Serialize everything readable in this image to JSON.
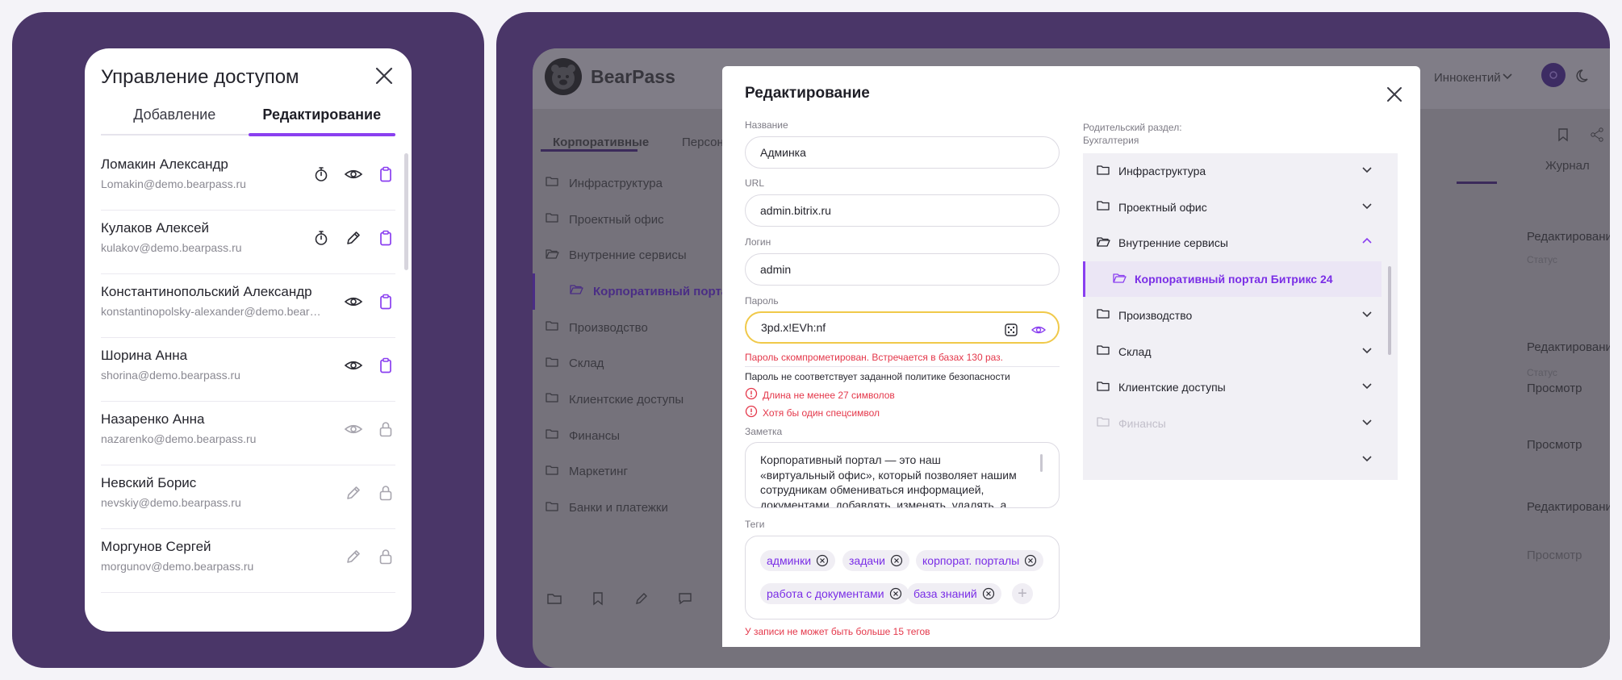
{
  "access_panel": {
    "title": "Управление доступом",
    "tabs": [
      {
        "label": "Добавление",
        "active": false
      },
      {
        "label": "Редактирование",
        "active": true
      }
    ],
    "users": [
      {
        "name": "Ломакин Александр",
        "email": "Lomakin@demo.bearpass.ru",
        "actions": [
          "timer-icon",
          "eye-icon",
          "clipboard-icon"
        ]
      },
      {
        "name": "Кулаков Алексей",
        "email": "kulakov@demo.bearpass.ru",
        "actions": [
          "timer-icon",
          "pencil-icon",
          "clipboard-icon"
        ]
      },
      {
        "name": "Константинопольский Александр",
        "email": "konstantinopolsky-alexander@demo.bearpass.ru",
        "actions": [
          "eye-icon",
          "clipboard-icon"
        ]
      },
      {
        "name": "Шорина Анна",
        "email": "shorina@demo.bearpass.ru",
        "actions": [
          "eye-icon",
          "clipboard-icon"
        ]
      },
      {
        "name": "Назаренко Анна",
        "email": "nazarenko@demo.bearpass.ru",
        "actions": [
          "eye-faded-icon",
          "lock-icon"
        ]
      },
      {
        "name": "Невский Борис",
        "email": "nevskiy@demo.bearpass.ru",
        "actions": [
          "pencil-faded-icon",
          "lock-icon"
        ]
      },
      {
        "name": "Моргунов Сергей",
        "email": "morgunov@demo.bearpass.ru",
        "actions": [
          "pencil-faded-icon",
          "lock-icon"
        ]
      }
    ]
  },
  "app": {
    "brand": "BearPass",
    "user_name": "Иннокентий",
    "tabs": [
      "Корпоративные",
      "Персон"
    ],
    "tree": [
      {
        "label": "Инфраструктура",
        "sub": false
      },
      {
        "label": "Проектный офис",
        "sub": false
      },
      {
        "label": "Внутренние сервисы",
        "sub": false,
        "open": true
      },
      {
        "label": "Корпоративный портал Битр",
        "sub": true
      },
      {
        "label": "Производство",
        "sub": false
      },
      {
        "label": "Склад",
        "sub": false
      },
      {
        "label": "Клиентские доступы",
        "sub": false
      },
      {
        "label": "Финансы",
        "sub": false
      },
      {
        "label": "Маркетинг",
        "sub": false
      },
      {
        "label": "Банки и платежки",
        "sub": false
      }
    ],
    "journal_tab": "Журнал",
    "permissions": [
      {
        "label": "",
        "value": "Редактирование"
      },
      {
        "label": "Статус",
        "value": ""
      },
      {
        "label": "",
        "value": "Редактирование"
      },
      {
        "label": "Статус",
        "value": "Просмотр"
      },
      {
        "label": "",
        "value": "Просмотр"
      },
      {
        "label": "",
        "value": "Редактирование"
      },
      {
        "label": "",
        "value": "Просмотр"
      }
    ]
  },
  "edit_modal": {
    "title": "Редактирование",
    "name_label": "Название",
    "name_value": "Админка",
    "url_label": "URL",
    "url_value": "admin.bitrix.ru",
    "login_label": "Логин",
    "login_value": "admin",
    "password_label": "Пароль",
    "password_value": "3pd.x!EVh:nf",
    "password_compromised": "Пароль скомпрометирован. Встречается в базах 130 раз.",
    "policy_text": "Пароль не соответствует заданной политике безопасности",
    "policy_rules": [
      "Длина не менее 27 символов",
      "Хотя бы один спецсимвол"
    ],
    "note_label": "Заметка",
    "note_text": "Корпоративный портал — это наш «виртуальный офис», который позволяет нашим сотрудникам обмениваться информацией, документами, добавлять, изменять, удалять, а главное совместно",
    "tags_label": "Теги",
    "tags": [
      "админки",
      "задачи",
      "корпорат. порталы",
      "работа с документами",
      "база знаний"
    ],
    "tags_limit": "У записи не может быть больше 15 тегов",
    "parent_label": "Родительский раздел:",
    "parent_value": "Бухгалтерия",
    "parent_tree": [
      {
        "label": "Инфраструктура",
        "state": "closed"
      },
      {
        "label": "Проектный офис",
        "state": "closed"
      },
      {
        "label": "Внутренние сервисы",
        "state": "open"
      },
      {
        "label": "Корпоративный портал Битрикс 24",
        "state": "selected"
      },
      {
        "label": "Производство",
        "state": "closed"
      },
      {
        "label": "Склад",
        "state": "closed"
      },
      {
        "label": "Клиентские доступы",
        "state": "closed"
      },
      {
        "label": "Финансы",
        "state": "faded"
      },
      {
        "label": "",
        "state": "faded"
      }
    ]
  },
  "colors": {
    "accent": "#8a3ff0",
    "panel_bg": "#4a3668",
    "error": "#e4374a",
    "warning_border": "#f0c94a"
  }
}
